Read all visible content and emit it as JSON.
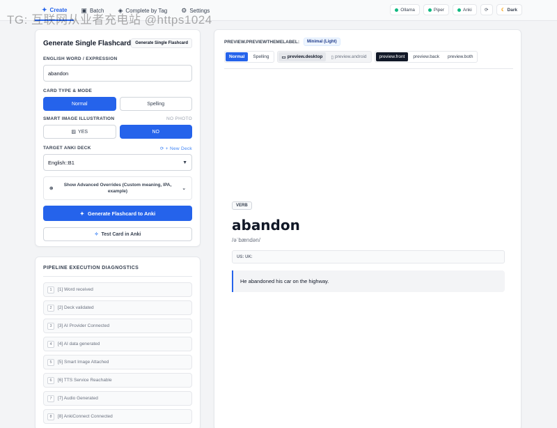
{
  "watermark": "TG: 互联网从业者充电站 @https1024",
  "nav": {
    "tabs": [
      {
        "label": "Create",
        "icon": "sparkle-icon"
      },
      {
        "label": "Batch",
        "icon": "box-icon"
      },
      {
        "label": "Complete by Tag",
        "icon": "tag-icon"
      },
      {
        "label": "Settings",
        "icon": "gear-icon"
      }
    ],
    "status": [
      {
        "label": "Ollama"
      },
      {
        "label": "Piper"
      },
      {
        "label": "Anki"
      }
    ],
    "dark_label": "Dark"
  },
  "form": {
    "title": "Generate Single Flashcard",
    "header_button": "Generate Single Flashcard",
    "word_label": "ENGLISH WORD / EXPRESSION",
    "word_value": "abandon",
    "type_label": "CARD TYPE & MODE",
    "type_options": [
      "Normal",
      "Spelling"
    ],
    "image_label": "SMART IMAGE ILLUSTRATION",
    "image_meta": "NO PHOTO",
    "image_options": [
      "YES",
      "NO"
    ],
    "deck_label": "TARGET ANKI DECK",
    "new_deck": "+ New Deck",
    "deck_value": "English::B1",
    "advanced": "Show Advanced Overrides (Custom meaning, IPA, example)",
    "generate_button": "Generate Flashcard to Anki",
    "test_button": "Test Card in Anki"
  },
  "diagnostics": {
    "title": "PIPELINE EXECUTION DIAGNOSTICS",
    "items": [
      {
        "num": "1",
        "label": "[1] Word received"
      },
      {
        "num": "2",
        "label": "[2] Deck validated"
      },
      {
        "num": "3",
        "label": "[3] AI Provider Connected"
      },
      {
        "num": "4",
        "label": "[4] AI data generated"
      },
      {
        "num": "5",
        "label": "[5] Smart Image Attached"
      },
      {
        "num": "6",
        "label": "[6] TTS Service Reachable"
      },
      {
        "num": "7",
        "label": "[7] Audio Generated"
      },
      {
        "num": "8",
        "label": "[8] AnkiConnect Connected"
      }
    ]
  },
  "preview": {
    "theme_label": "PREVIEW.PREVIEWTHEMELABEL:",
    "theme_value": "Minimal (Light)",
    "mode_options": [
      "Normal",
      "Spelling"
    ],
    "device_options": [
      "preview.desktop",
      "preview.android"
    ],
    "side_options": [
      "preview.front",
      "preview.back",
      "preview.both"
    ],
    "card": {
      "pos": "VERB",
      "word": "abandon",
      "ipa": "/əˈbændən/",
      "audio_labels": "US: UK:",
      "example": "He abandoned his car on the highway."
    }
  }
}
